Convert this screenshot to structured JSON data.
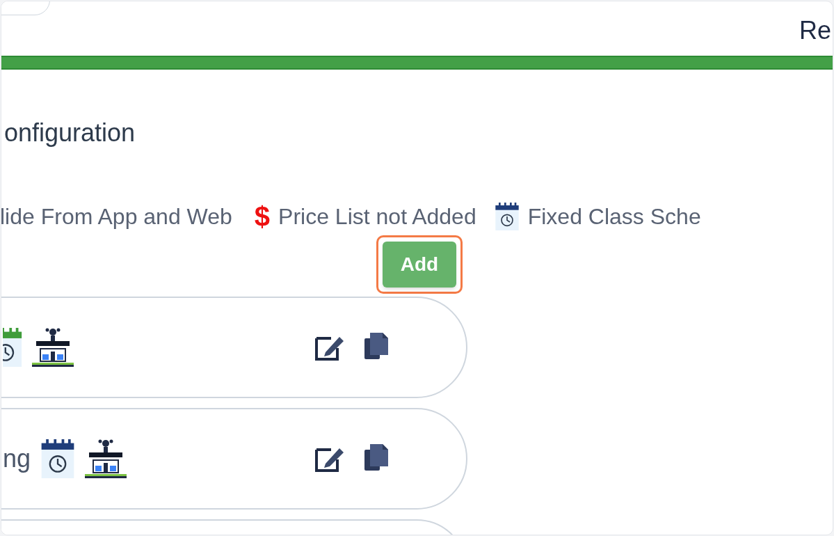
{
  "header": {
    "title": "Re"
  },
  "section": {
    "title": "onfiguration"
  },
  "legend": [
    {
      "kind": "text",
      "label": "lide From App and Web"
    },
    {
      "kind": "price",
      "symbol": "$",
      "label": "Price List not Added"
    },
    {
      "kind": "schedule",
      "label": "Fixed Class Sche"
    }
  ],
  "add_button": {
    "label": "Add",
    "highlighted": true
  },
  "items": [
    {
      "kind": "card",
      "badges": [
        {
          "kind": "calendar-partial"
        },
        {
          "kind": "building"
        }
      ]
    },
    {
      "kind": "card",
      "text": "ng",
      "badges": [
        {
          "kind": "calendar"
        },
        {
          "kind": "building"
        }
      ]
    },
    {
      "kind": "card-edge"
    }
  ]
}
